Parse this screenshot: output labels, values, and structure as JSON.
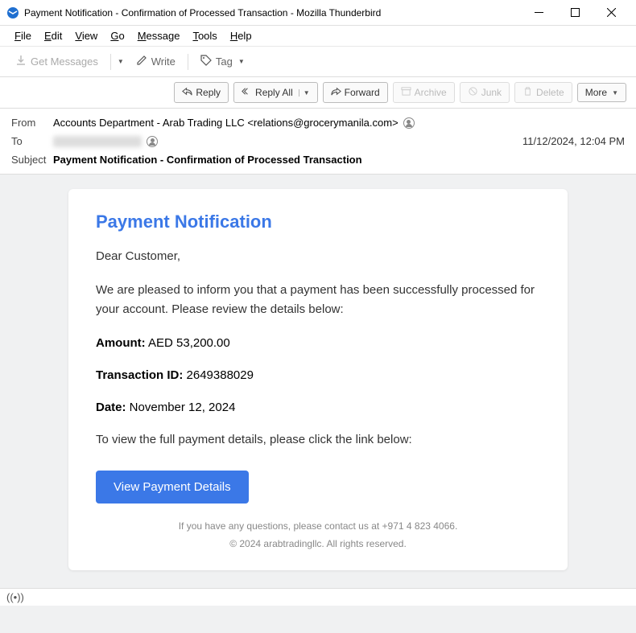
{
  "titlebar": {
    "text": "Payment Notification - Confirmation of Processed Transaction - Mozilla Thunderbird"
  },
  "menubar": {
    "file": "File",
    "edit": "Edit",
    "view": "View",
    "go": "Go",
    "message": "Message",
    "tools": "Tools",
    "help": "Help"
  },
  "toolbar": {
    "get_messages": "Get Messages",
    "write": "Write",
    "tag": "Tag"
  },
  "actions": {
    "reply": "Reply",
    "reply_all": "Reply All",
    "forward": "Forward",
    "archive": "Archive",
    "junk": "Junk",
    "delete": "Delete",
    "more": "More"
  },
  "headers": {
    "from_label": "From",
    "from_value": "Accounts Department - Arab Trading LLC <relations@grocerymanila.com>",
    "to_label": "To",
    "subject_label": "Subject",
    "subject_value": "Payment Notification - Confirmation of Processed Transaction",
    "date": "11/12/2024, 12:04 PM"
  },
  "email": {
    "title": "Payment Notification",
    "greeting": "Dear Customer,",
    "body1": "We are pleased to inform you that a payment has been successfully processed for your account. Please review the details below:",
    "amount_label": "Amount:",
    "amount_value": " AED 53,200.00",
    "txn_label": "Transaction ID:",
    "txn_value": " 2649388029",
    "date_label": "Date:",
    "date_value": " November 12, 2024",
    "body2": "To view the full payment details, please click the link below:",
    "button": "View Payment Details",
    "footer1": "If you have any questions, please contact us at +971 4 823 4066.",
    "footer2": "© 2024 arabtradingllc. All rights reserved."
  }
}
